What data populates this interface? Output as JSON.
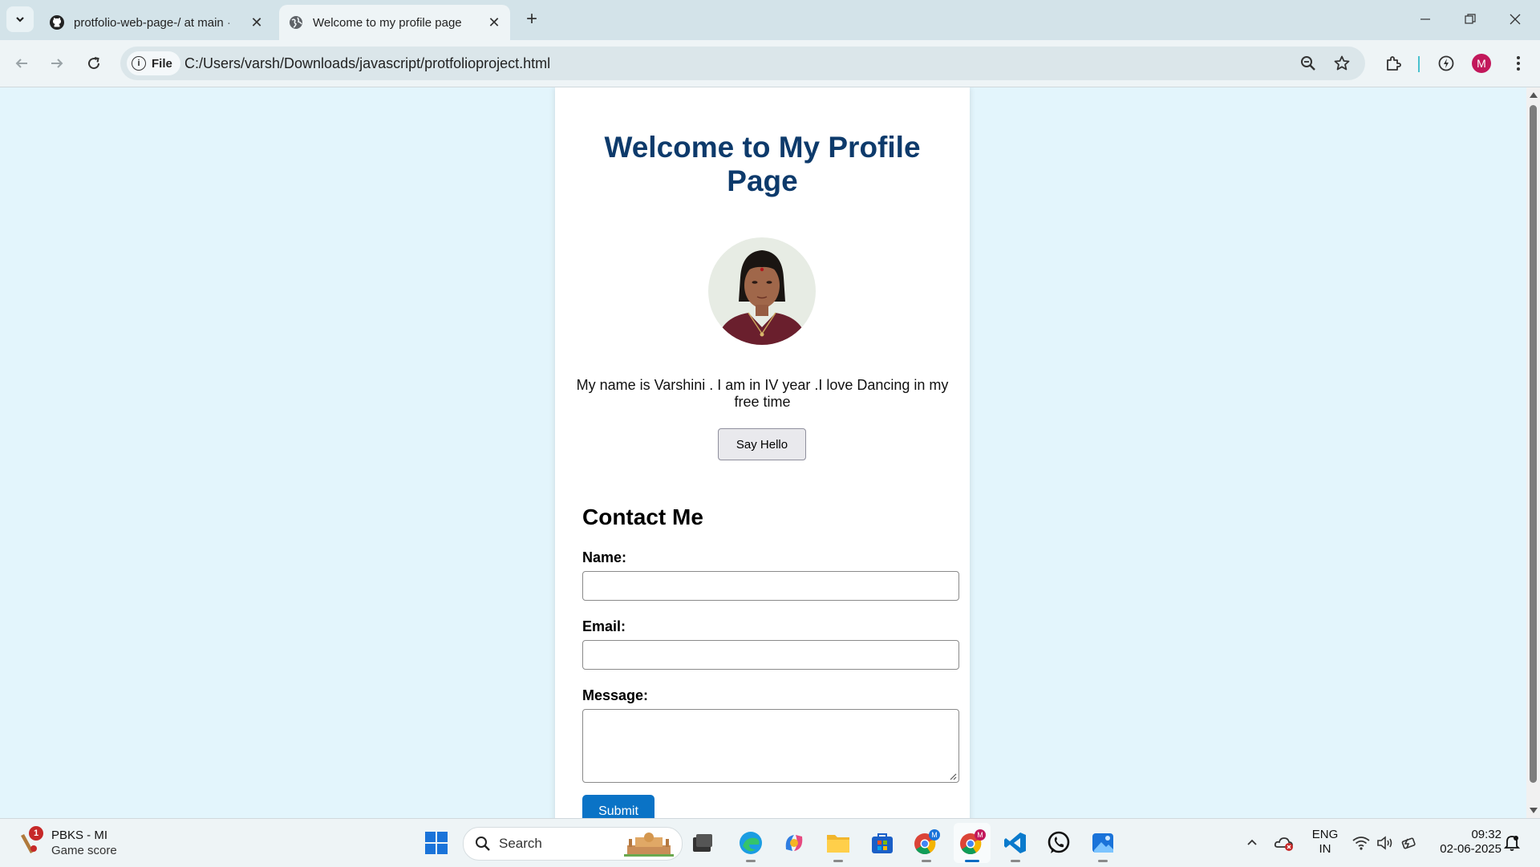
{
  "browser": {
    "tabs": [
      {
        "title": "protfolio-web-page-/ at main ·",
        "active": false
      },
      {
        "title": "Welcome to my profile page",
        "active": true
      }
    ],
    "site_chip": "File",
    "url": "C:/Users/varsh/Downloads/javascript/protfolioproject.html",
    "profile_initial": "M"
  },
  "page": {
    "heading": "Welcome to My Profile Page",
    "bio": "My name is Varshini . I am in IV year .I love Dancing in my free time",
    "hello_button": "Say Hello",
    "contact_heading": "Contact Me",
    "form": {
      "name_label": "Name:",
      "name_value": "",
      "email_label": "Email:",
      "email_value": "",
      "message_label": "Message:",
      "message_value": "",
      "submit_label": "Submit"
    },
    "colors": {
      "background": "#e3f5fc",
      "heading": "#0d3a6b",
      "submit": "#0a73c6"
    }
  },
  "taskbar": {
    "weather": {
      "badge": "1",
      "title": "PBKS - MI",
      "subtitle": "Game score"
    },
    "search_label": "Search",
    "apps": [
      "start-icon",
      "search",
      "task-view-icon",
      "edge-icon",
      "copilot-icon",
      "file-explorer-icon",
      "store-icon",
      "chrome-profile-icon",
      "chrome-icon",
      "vscode-icon",
      "whatsapp-icon",
      "photos-icon"
    ],
    "language": {
      "line1": "ENG",
      "line2": "IN"
    },
    "time": "09:32",
    "date": "02-06-2025"
  }
}
